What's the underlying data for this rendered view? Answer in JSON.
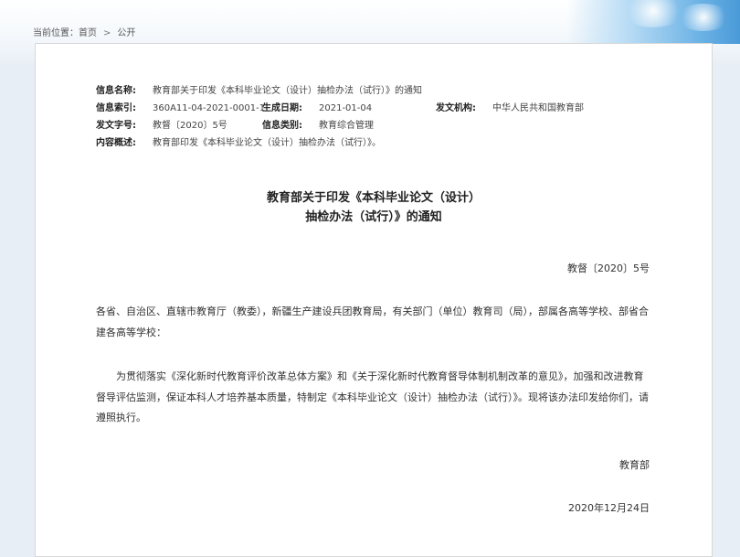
{
  "breadcrumb": {
    "prefix": "当前位置：",
    "home": "首页",
    "separator": ">",
    "current": "公开"
  },
  "meta": {
    "name_label": "信息名称:",
    "name_value": "教育部关于印发《本科毕业论文（设计）抽检办法（试行）》的通知",
    "index_label": "信息索引:",
    "index_value": "360A11-04-2021-0001-1",
    "date_label": "生成日期:",
    "date_value": "2021-01-04",
    "org_label": "发文机构:",
    "org_value": "中华人民共和国教育部",
    "docno_label": "发文字号:",
    "docno_value": "教督〔2020〕5号",
    "category_label": "信息类别:",
    "category_value": "教育综合管理",
    "summary_label": "内容概述:",
    "summary_value": "教育部印发《本科毕业论文（设计）抽检办法（试行）》。"
  },
  "document": {
    "title_line1": "教育部关于印发《本科毕业论文（设计）",
    "title_line2": "抽检办法（试行）》的通知",
    "doc_number": "教督〔2020〕5号",
    "recipients": "各省、自治区、直辖市教育厅（教委），新疆生产建设兵团教育局，有关部门（单位）教育司（局），部属各高等学校、部省合建各高等学校：",
    "body": "为贯彻落实《深化新时代教育评价改革总体方案》和《关于深化新时代教育督导体制机制改革的意见》，加强和改进教育督导评估监测，保证本科人才培养基本质量，特制定《本科毕业论文（设计）抽检办法（试行）》。现将该办法印发给你们，请遵照执行。",
    "signer": "教育部",
    "date": "2020年12月24日"
  }
}
